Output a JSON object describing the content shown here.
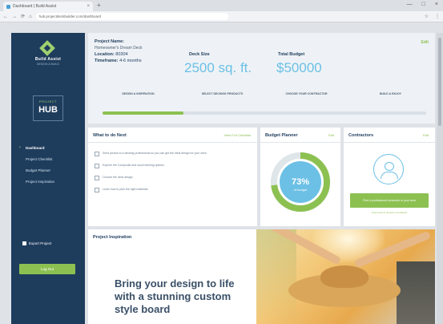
{
  "browser": {
    "tab_title": "Dashboard | Build Assist",
    "tab_close": "×",
    "new_tab": "+",
    "url": "hub.projectdeckbuilder.com/dashboard",
    "window_controls": [
      "—",
      "□",
      "×"
    ],
    "nav_buttons": [
      "←",
      "→",
      "⟳",
      "⌂"
    ],
    "addr_icons": [
      "☆",
      "⋮"
    ]
  },
  "sidebar": {
    "brand": "Build Assist",
    "brand_sub": "DESIGN & BUILD",
    "hub_small": "PROJECT",
    "hub_big": "HUB",
    "nav": [
      {
        "label": "Dashboard",
        "active": true
      },
      {
        "label": "Project Checklist",
        "active": false
      },
      {
        "label": "Budget Planner",
        "active": false
      },
      {
        "label": "Project Inspiration",
        "active": false
      }
    ],
    "export": "Export Project",
    "logout": "Log Out"
  },
  "project": {
    "name_label": "Project Name:",
    "name_value": "Homeowner's Dream Deck",
    "location_label": "Location:",
    "location_value": "80304",
    "timeframe_label": "Timeframe:",
    "timeframe_value": "4-6 months",
    "deck_size_label": "Deck Size",
    "deck_size_value": "2500 sq. ft.",
    "budget_label": "Total Budget",
    "budget_value": "$50000",
    "edit": "Edit",
    "steps": [
      "DESIGN & INSPIRATION",
      "SELECT DECKING PRODUCTS",
      "CHOOSE YOUR CONTRACTOR",
      "BUILD & ENJOY"
    ],
    "progress": 0.25
  },
  "todo": {
    "title": "What to do Next",
    "link": "View Full Checklist",
    "items": [
      "Send photos to a decking professional so you can get the ideal design for your deck",
      "Explore the Composite and wood decking options",
      "Choose the deck design",
      "Learn how to plan the right materials"
    ]
  },
  "budget_planner": {
    "title": "Budget Planner",
    "edit": "Edit",
    "percent_label": "73%",
    "percent_sub": "of budget",
    "percent": 0.73
  },
  "contractor": {
    "title": "Contractors",
    "edit": "Edit",
    "button": "Find a professional contractor in your area",
    "link": "Learn how to choose a contractor"
  },
  "inspiration": {
    "title": "Project Inspiration",
    "headline": "Bring your design to life with a stunning custom style board"
  },
  "colors": {
    "navy": "#1e3c5c",
    "green": "#8cc152",
    "blue": "#6cc0e5"
  }
}
